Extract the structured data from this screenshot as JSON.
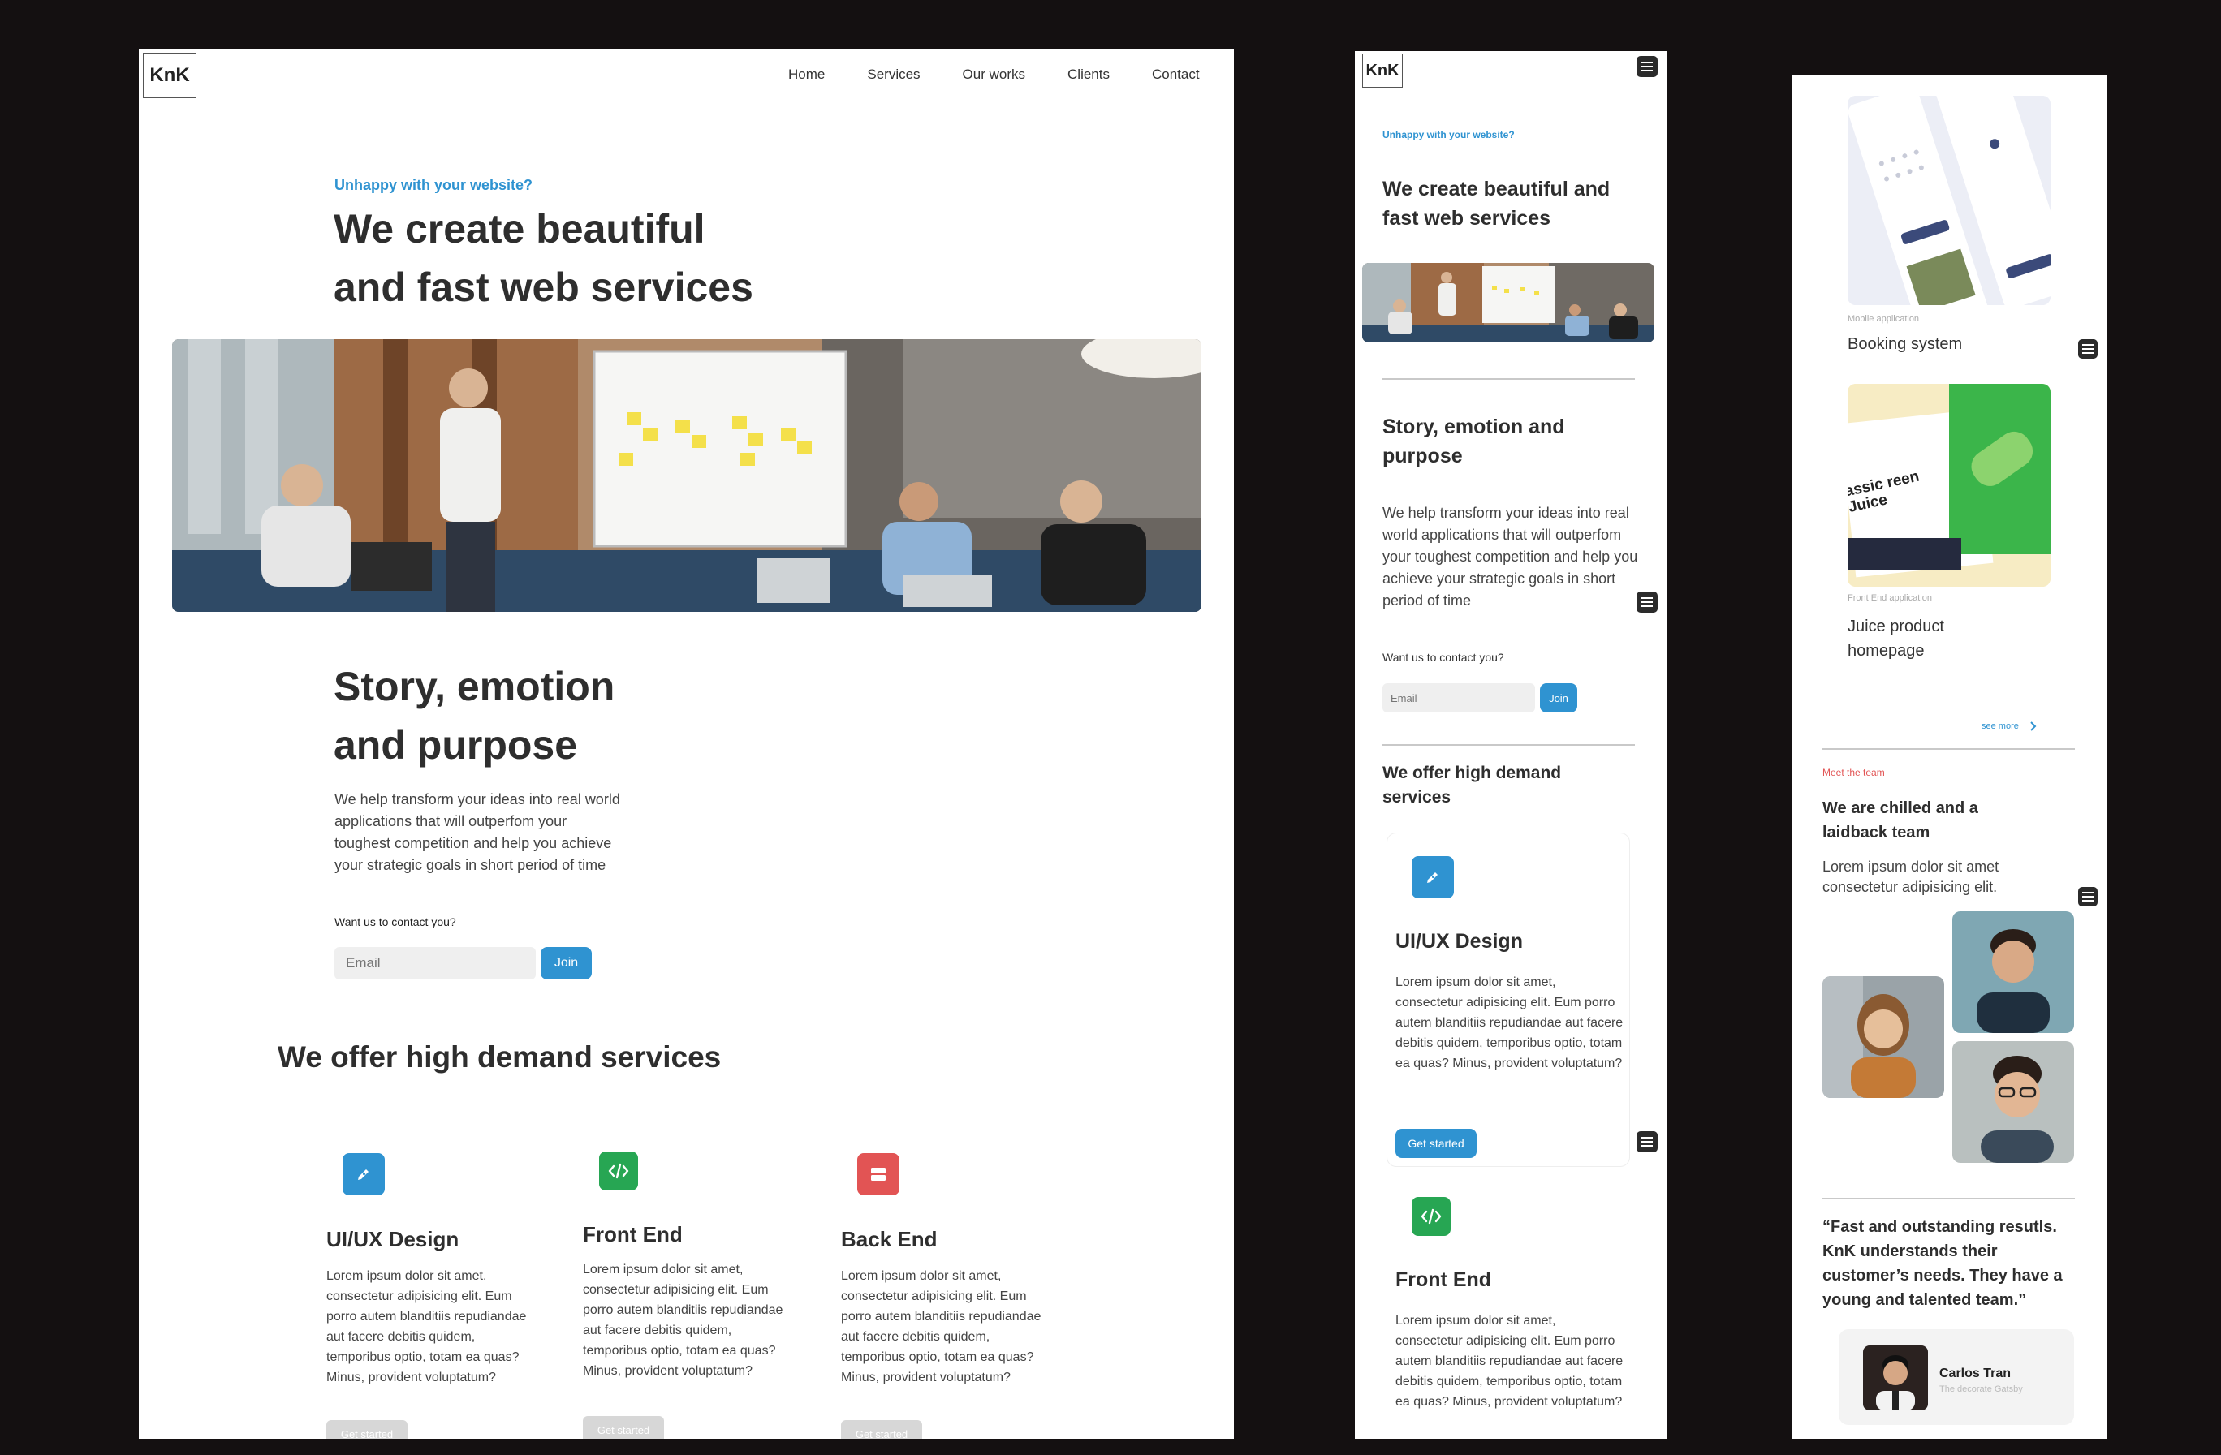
{
  "brand": {
    "logo": "KnK"
  },
  "nav": {
    "items": [
      "Home",
      "Services",
      "Our works",
      "Clients",
      "Contact"
    ]
  },
  "hero": {
    "eyebrow": "Unhappy with your website?",
    "title_line1": "We create beautiful",
    "title_line2": "and fast web services",
    "title_mobile": "We create beautiful and fast web services"
  },
  "story": {
    "title_line1": "Story, emotion",
    "title_line2": "and purpose",
    "title_mobile": "Story, emotion and purpose",
    "body": "We help transform your ideas into real world applications that will outperfom your toughest competition and help you achieve your strategic goals in short period of time",
    "contact_prompt": "Want us to contact you?",
    "email_placeholder": "Email",
    "join_label": "Join"
  },
  "services": {
    "heading": "We offer high demand services",
    "cta_label": "Get started",
    "items": [
      {
        "title": "UI/UX Design",
        "icon": "pen-icon",
        "color": "#2f93d1",
        "desc": "Lorem ipsum dolor sit amet, consectetur adipisicing elit. Eum porro autem blanditiis repudiandae aut facere debitis quidem, temporibus optio, totam ea quas? Minus, provident voluptatum?"
      },
      {
        "title": "Front End",
        "icon": "code-icon",
        "color": "#27a653",
        "desc": "Lorem ipsum dolor sit amet, consectetur adipisicing elit. Eum porro autem blanditiis repudiandae aut facere debitis quidem, temporibus optio, totam ea quas? Minus, provident voluptatum?"
      },
      {
        "title": "Back End",
        "icon": "server-icon",
        "color": "#e25454",
        "desc": "Lorem ipsum dolor sit amet, consectetur adipisicing elit. Eum porro autem blanditiis repudiandae aut facere debitis quidem, temporibus optio, totam ea quas? Minus, provident voluptatum?"
      }
    ]
  },
  "works": {
    "items": [
      {
        "category": "Mobile application",
        "title": "Booking system"
      },
      {
        "category": "Front End application",
        "title": "Juice product homepage"
      }
    ],
    "see_more": "see more",
    "juice_text": "assic reen Juice"
  },
  "team": {
    "eyebrow": "Meet the team",
    "title": "We are chilled and a laidback team",
    "body": "Lorem ipsum dolor sit amet consectetur adipisicing elit."
  },
  "testimonial": {
    "quote": "“Fast and outstanding resutls. KnK understands their customer’s needs. They have a young and talented team.”",
    "name": "Carlos Tran",
    "role": "The decorate Gatsby"
  }
}
